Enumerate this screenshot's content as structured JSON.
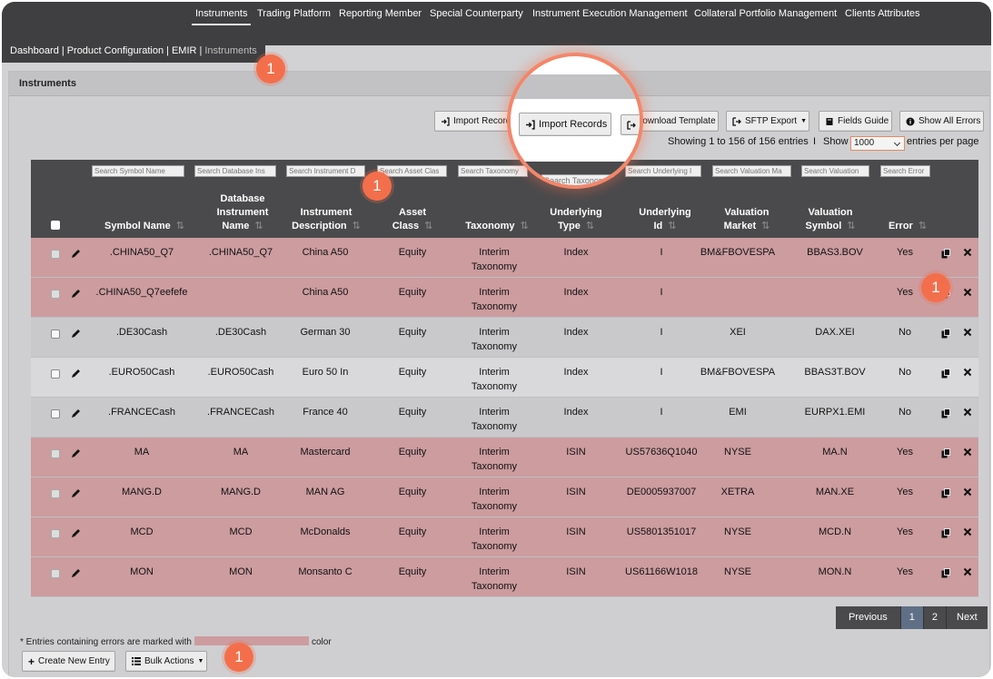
{
  "nav": {
    "items": [
      "Instruments",
      "Trading Platform",
      "Reporting Member",
      "Special Counterparty",
      "Instrument Execution Management",
      "Collateral Portfolio Management",
      "Clients Attributes"
    ]
  },
  "breadcrumb": {
    "items": [
      "Dashboard",
      "Product Configuration",
      "EMIR",
      "Instruments"
    ]
  },
  "panel": {
    "title": "Instruments"
  },
  "toolbar": {
    "import_small": "Import Records",
    "import": "Import Records",
    "download": "Download Template",
    "sftp": "SFTP Export",
    "fields_guide": "Fields Guide",
    "show_errors": "Show All Errors"
  },
  "info": {
    "showing": "Showing 1 to 156 of 156 entries",
    "sep": "I",
    "show": "Show",
    "page_size": "1000",
    "per_page": "entries per page"
  },
  "search": {
    "placeholders": [
      "Search Symbol Name",
      "Search Database Ins",
      "Search Instrument D",
      "Search Asset Clas",
      "Search Taxonomy",
      "Search Taxonomy",
      "Search Underlying I",
      "Search Valuation Ma",
      "Search Valuation",
      "Search Error"
    ]
  },
  "table": {
    "headers": {
      "symbol": "Symbol Name",
      "db_line1": "Database",
      "db_line2": "Instrument",
      "db_line3": "Name",
      "desc_line1": "Instrument",
      "desc_line2": "Description",
      "asset_line1": "Asset",
      "asset_line2": "Class",
      "taxonomy": "Taxonomy",
      "utype_line1": "Underlying",
      "utype_line2": "Type",
      "uid_line1": "Underlying",
      "uid_line2": "Id",
      "vmarket_line1": "Valuation",
      "vmarket_line2": "Market",
      "vsymbol_line1": "Valuation",
      "vsymbol_line2": "Symbol",
      "error": "Error"
    },
    "rows": [
      {
        "symbol": ".CHINA50_Q7",
        "db": ".CHINA50_Q7",
        "desc": "China A50",
        "asset": "Equity",
        "tax1": "Interim",
        "tax2": "Taxonomy",
        "utype": "Index",
        "uid": "I",
        "vmarket": "BM&FBOVESPA",
        "vsymbol": "BBAS3.BOV",
        "error": "Yes"
      },
      {
        "symbol": ".CHINA50_Q7eefefe",
        "db": "",
        "desc": "China A50",
        "asset": "Equity",
        "tax1": "Interim",
        "tax2": "Taxonomy",
        "utype": "Index",
        "uid": "I",
        "vmarket": "",
        "vsymbol": "",
        "error": "Yes"
      },
      {
        "symbol": ".DE30Cash",
        "db": ".DE30Cash",
        "desc": "German 30",
        "asset": "Equity",
        "tax1": "Interim",
        "tax2": "Taxonomy",
        "utype": "Index",
        "uid": "I",
        "vmarket": "XEI",
        "vsymbol": "DAX.XEI",
        "error": "No"
      },
      {
        "symbol": ".EURO50Cash",
        "db": ".EURO50Cash",
        "desc": "Euro 50 In",
        "asset": "Equity",
        "tax1": "Interim",
        "tax2": "Taxonomy",
        "utype": "Index",
        "uid": "I",
        "vmarket": "BM&FBOVESPA",
        "vsymbol": "BBAS3T.BOV",
        "error": "No"
      },
      {
        "symbol": ".FRANCECash",
        "db": ".FRANCECash",
        "desc": "France 40",
        "asset": "Equity",
        "tax1": "Interim",
        "tax2": "Taxonomy",
        "utype": "Index",
        "uid": "I",
        "vmarket": "EMI",
        "vsymbol": "EURPX1.EMI",
        "error": "No"
      },
      {
        "symbol": "MA",
        "db": "MA",
        "desc": "Mastercard",
        "asset": "Equity",
        "tax1": "Interim",
        "tax2": "Taxonomy",
        "utype": "ISIN",
        "uid": "US57636Q1040",
        "vmarket": "NYSE",
        "vsymbol": "MA.N",
        "error": "Yes"
      },
      {
        "symbol": "MANG.D",
        "db": "MANG.D",
        "desc": "MAN AG",
        "asset": "Equity",
        "tax1": "Interim",
        "tax2": "Taxonomy",
        "utype": "ISIN",
        "uid": "DE0005937007",
        "vmarket": "XETRA",
        "vsymbol": "MAN.XE",
        "error": "Yes"
      },
      {
        "symbol": "MCD",
        "db": "MCD",
        "desc": "McDonalds",
        "asset": "Equity",
        "tax1": "Interim",
        "tax2": "Taxonomy",
        "utype": "ISIN",
        "uid": "US5801351017",
        "vmarket": "NYSE",
        "vsymbol": "MCD.N",
        "error": "Yes"
      },
      {
        "symbol": "MON",
        "db": "MON",
        "desc": "Monsanto C",
        "asset": "Equity",
        "tax1": "Interim",
        "tax2": "Taxonomy",
        "utype": "ISIN",
        "uid": "US61166W1018",
        "vmarket": "NYSE",
        "vsymbol": "MON.N",
        "error": "Yes"
      }
    ]
  },
  "pagination": {
    "previous": "Previous",
    "pages": [
      "1",
      "2"
    ],
    "next": "Next"
  },
  "footer": {
    "note_before": "* Entries containing errors are marked with",
    "note_after": "color",
    "create": "Create New Entry",
    "bulk": "Bulk Actions"
  },
  "markers": [
    "1",
    "1",
    "1",
    "1"
  ],
  "colors": {
    "error_row": "#cc9c9f",
    "header": "#4a4a4c",
    "marker": "#f36f4c"
  }
}
